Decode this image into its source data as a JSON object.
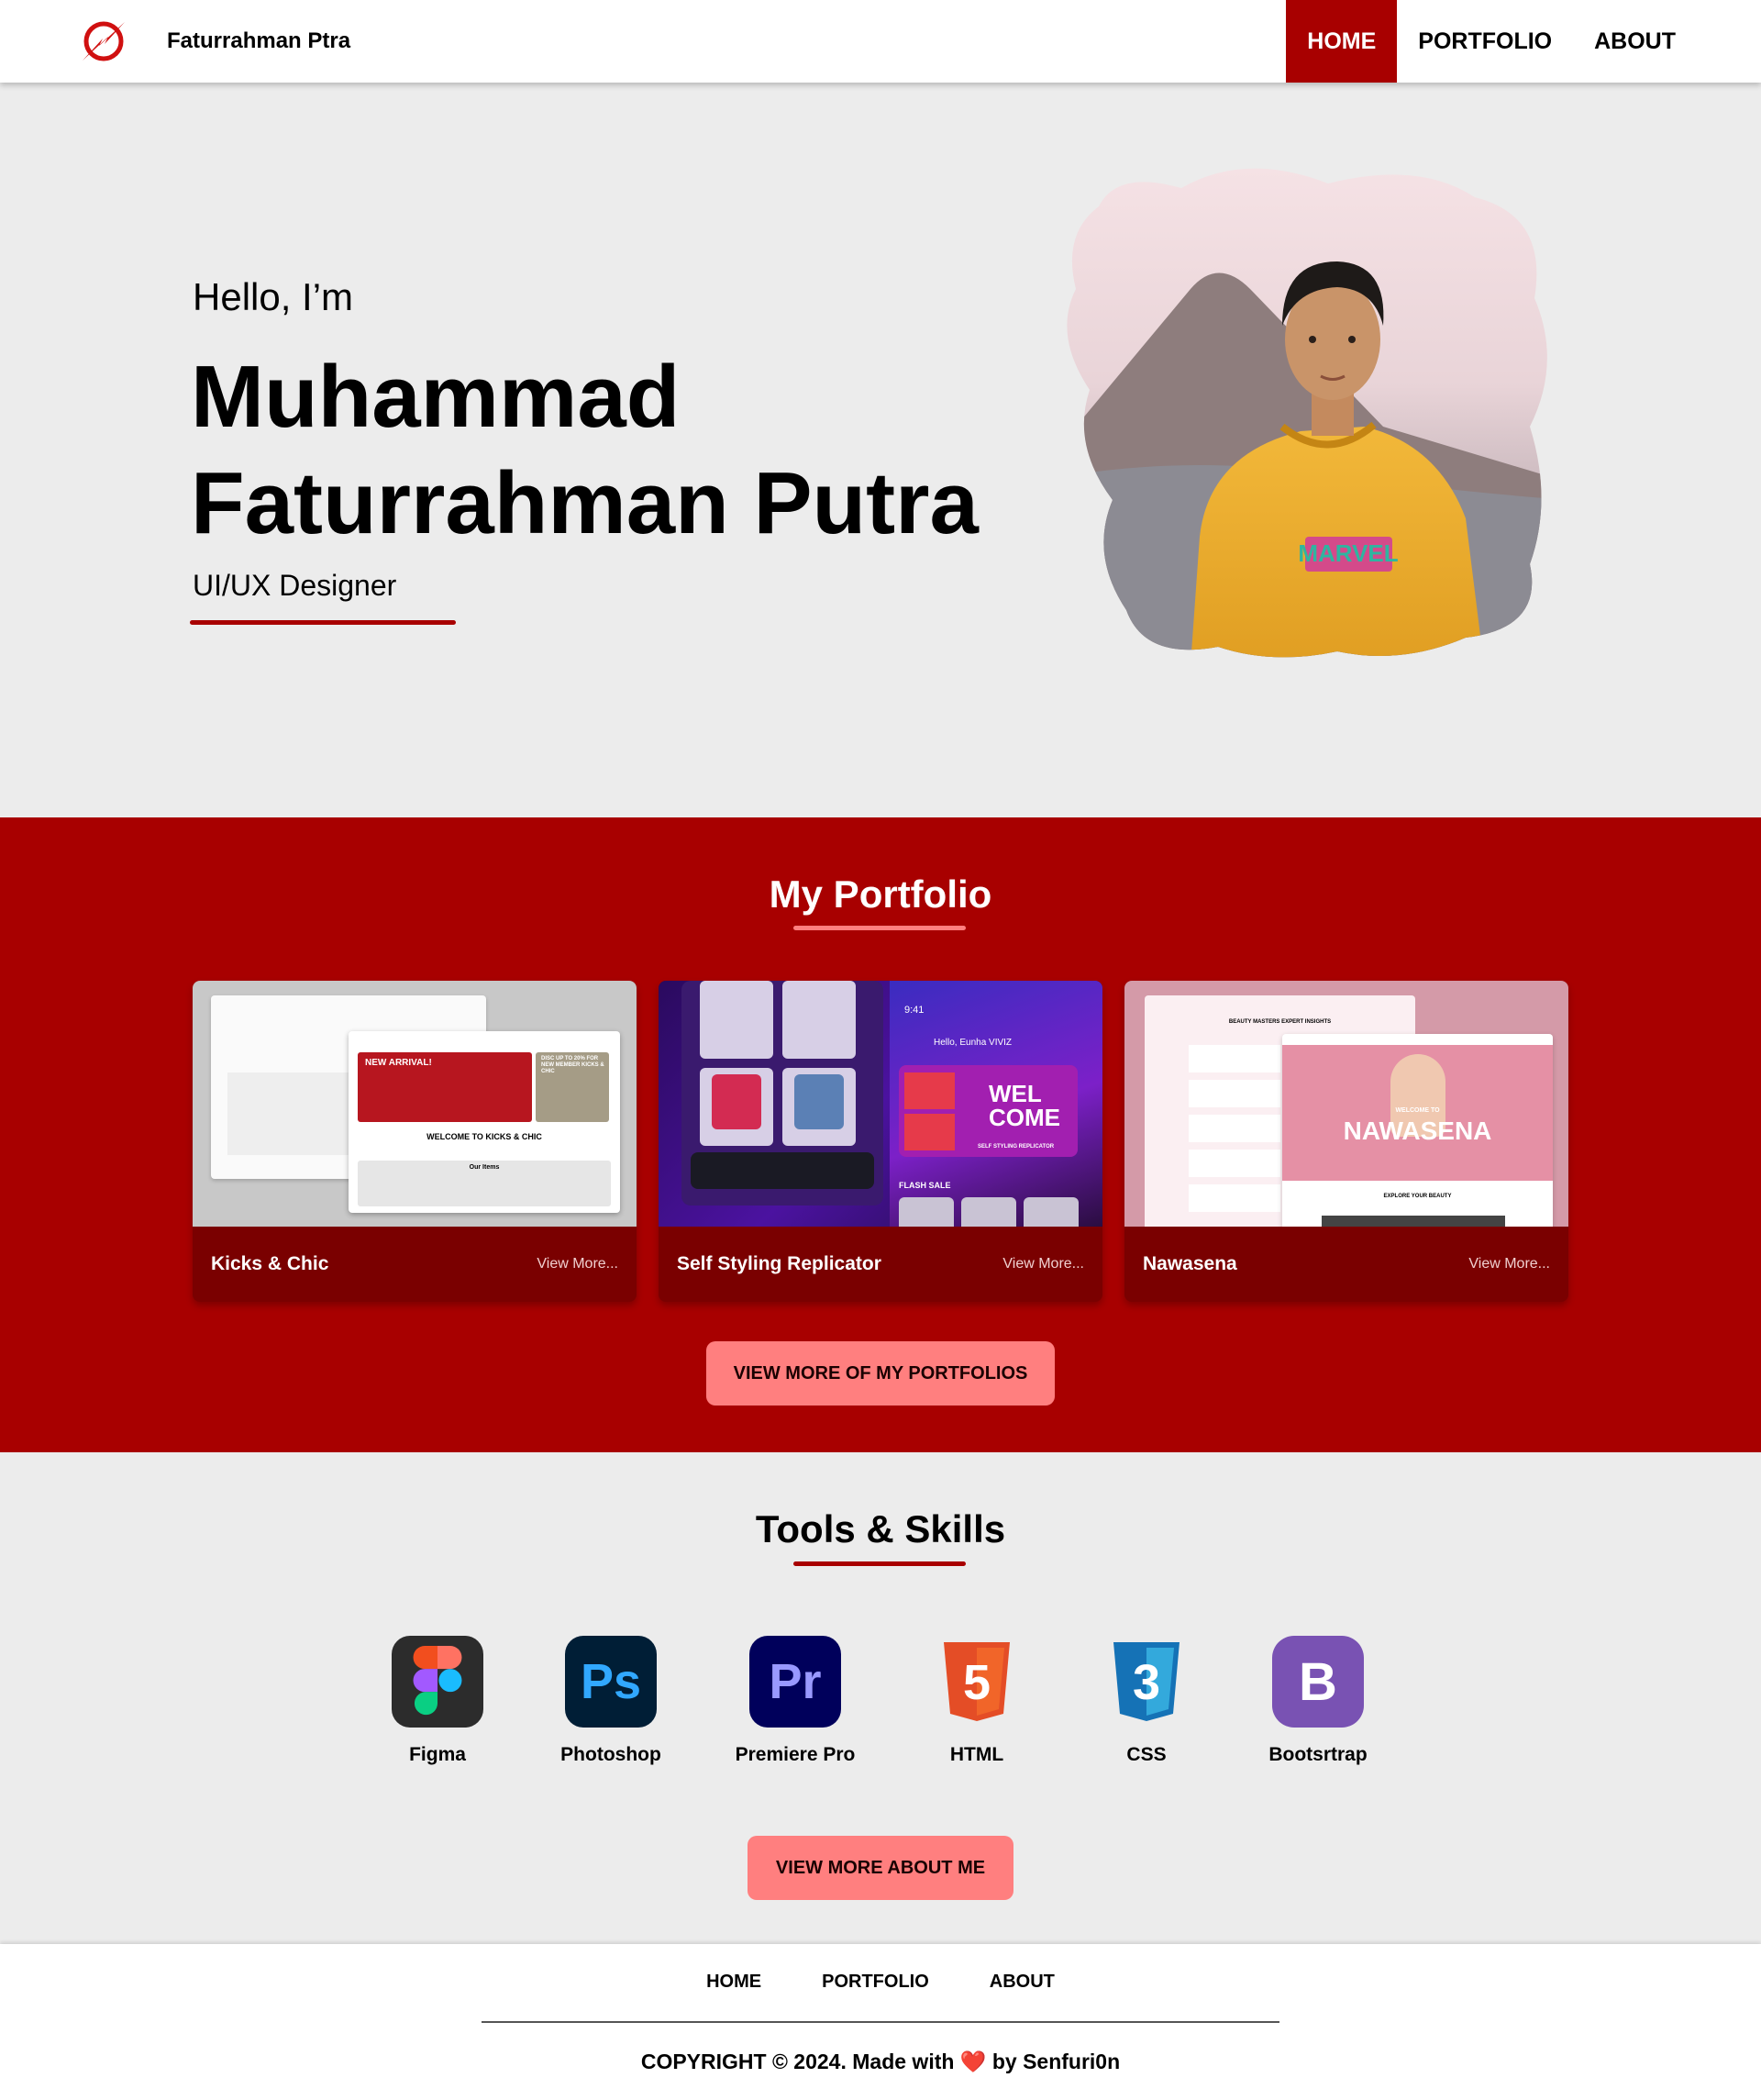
{
  "navbar": {
    "brand_name": "Faturrahman Ptra",
    "links": [
      "HOME",
      "PORTFOLIO",
      "ABOUT"
    ],
    "active": "HOME",
    "accent_color": "#a80000"
  },
  "hero": {
    "greeting": "Hello, I’m",
    "name_line1": "Muhammad",
    "name_line2": "Faturrahman Putra",
    "role": "UI/UX Designer",
    "photo": "profile-photo"
  },
  "portfolio": {
    "title": "My Portfolio",
    "cards": [
      {
        "title": "Kicks & Chic",
        "link": "View More...",
        "thumb": {
          "banner": "NEW ARRIVAL!",
          "promo": "DISC UP TO 20% FOR NEW MEMBER KICKS & CHIC",
          "welcome": "WELCOME TO KICKS & CHIC",
          "section": "Our Items"
        }
      },
      {
        "title": "Self Styling Replicator",
        "link": "View More...",
        "thumb": {
          "greeting": "Hello, Eunha VIVIZ",
          "welcome": "WEL COME",
          "tagline": "SELF STYLING REPLICATOR",
          "flash": "FLASH SALE",
          "time": "9:41"
        }
      },
      {
        "title": "Nawasena",
        "link": "View More...",
        "thumb": {
          "brand": "NAWASENA",
          "welcome": "WELCOME TO",
          "explore": "EXPLORE YOUR BEAUTY",
          "insights": "BEAUTY MASTERS EXPERT INSIGHTS"
        }
      }
    ],
    "button": "VIEW MORE OF MY PORTFOLIOS",
    "bg_color": "#a80000",
    "button_color": "#ff7f7f"
  },
  "skills": {
    "title": "Tools & Skills",
    "items": [
      {
        "label": "Figma",
        "icon": "figma-icon"
      },
      {
        "label": "Photoshop",
        "icon": "photoshop-icon",
        "glyph": "Ps"
      },
      {
        "label": "Premiere Pro",
        "icon": "premiere-pro-icon",
        "glyph": "Pr"
      },
      {
        "label": "HTML",
        "icon": "html5-icon",
        "glyph": "5"
      },
      {
        "label": "CSS",
        "icon": "css3-icon",
        "glyph": "3"
      },
      {
        "label": "Bootsrtrap",
        "icon": "bootstrap-icon",
        "glyph": "B"
      }
    ],
    "button": "VIEW MORE ABOUT ME"
  },
  "footer": {
    "links": [
      "HOME",
      "PORTFOLIO",
      "ABOUT"
    ],
    "copyright_prefix": "COPYRIGHT © 2024. Made with",
    "heart": "❤️",
    "copyright_suffix": "by Senfuri0n"
  }
}
